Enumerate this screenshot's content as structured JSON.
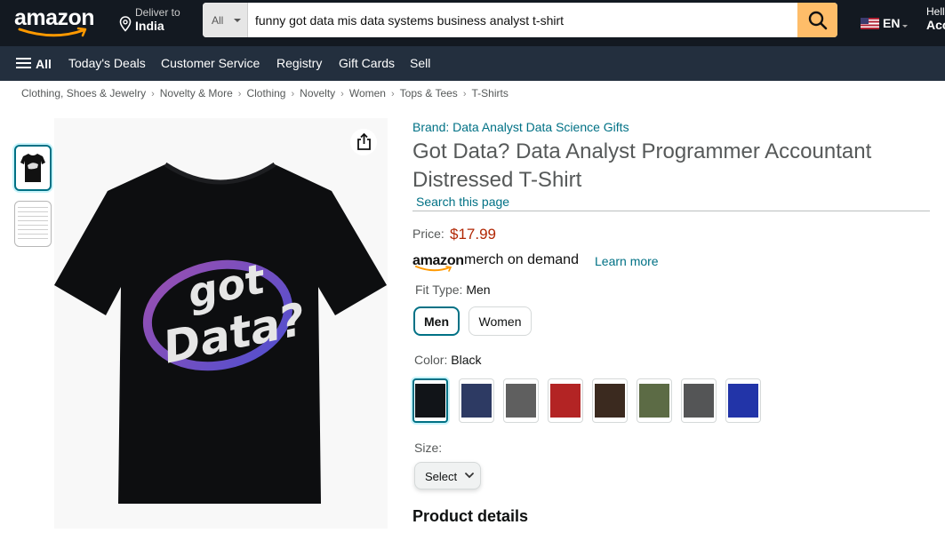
{
  "header": {
    "logo_text": "amazon",
    "deliver_to_label": "Deliver to",
    "deliver_to_location": "India",
    "search": {
      "category": "All",
      "query": "funny got data mis data systems business analyst t-shirt",
      "icon": "search-icon"
    },
    "language": "EN",
    "account_greeting": "Hell",
    "account_label": "Acc"
  },
  "nav": {
    "all_label": "All",
    "items": [
      "Today's Deals",
      "Customer Service",
      "Registry",
      "Gift Cards",
      "Sell"
    ]
  },
  "breadcrumb": [
    "Clothing, Shoes & Jewelry",
    "Novelty & More",
    "Clothing",
    "Novelty",
    "Women",
    "Tops & Tees",
    "T-Shirts"
  ],
  "gallery": {
    "share_icon": "share-icon",
    "shirt_text_line1": "got",
    "shirt_text_line2": "Data?"
  },
  "product": {
    "brand": "Brand: Data Analyst Data Science Gifts",
    "title": "Got Data? Data Analyst Programmer Accountant Distressed T-Shirt",
    "search_this_page": "Search this page",
    "price_label": "Price:",
    "price": "$17.99",
    "merch_amazon": "amazon",
    "merch_label": "merch on demand",
    "learn_more": "Learn more",
    "fit_label": "Fit Type:",
    "fit_selected": "Men",
    "fit_options": [
      "Men",
      "Women"
    ],
    "color_label": "Color:",
    "color_selected": "Black",
    "colors": [
      "#111418",
      "#2d3a63",
      "#5f5f5f",
      "#b32424",
      "#3b2a1f",
      "#5c6b45",
      "#545556",
      "#2234a8"
    ],
    "size_label": "Size:",
    "size_select": "Select",
    "details_heading": "Product details"
  }
}
